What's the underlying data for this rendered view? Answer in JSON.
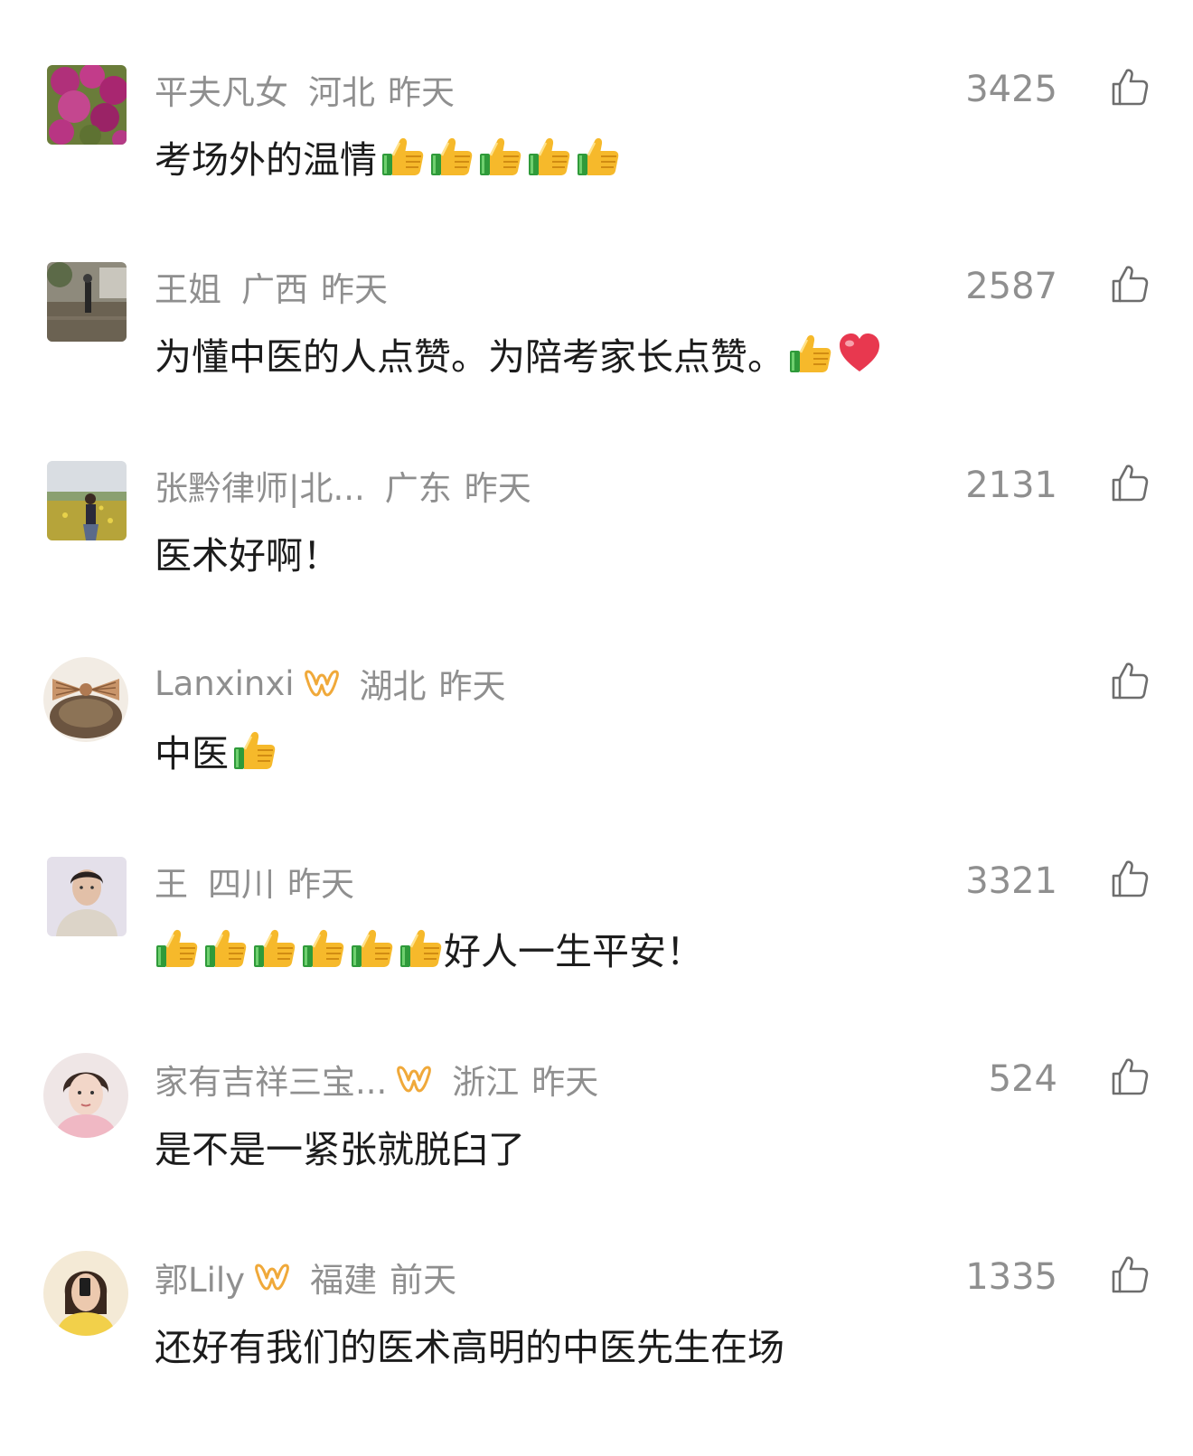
{
  "comments": [
    {
      "username": "平夫凡女",
      "location": "河北",
      "time": "昨天",
      "likes": "3425",
      "text": "考场外的温情",
      "vip": false
    },
    {
      "username": "王姐",
      "location": "广西",
      "time": "昨天",
      "likes": "2587",
      "text_part1": "为懂中医的人点赞。为陪考家长点赞。",
      "vip": false
    },
    {
      "username": "张黔律师|北...",
      "location": "广东",
      "time": "昨天",
      "likes": "2131",
      "text": "医术好啊！",
      "vip": false
    },
    {
      "username": "Lanxinxi",
      "location": "湖北",
      "time": "昨天",
      "likes": "",
      "text": "中医",
      "vip": true
    },
    {
      "username": "王",
      "location": "四川",
      "time": "昨天",
      "likes": "3321",
      "text": "好人一生平安！",
      "vip": false
    },
    {
      "username": "家有吉祥三宝...",
      "location": "浙江",
      "time": "昨天",
      "likes": "524",
      "text": "是不是一紧张就脱臼了",
      "vip": true
    },
    {
      "username": "郭Lily",
      "location": "福建",
      "time": "前天",
      "likes": "1335",
      "text": "还好有我们的医术高明的中医先生在场",
      "vip": true
    }
  ],
  "icons": {
    "like": "thumbs-up-outline-icon",
    "emoji_thumbs": "thumbs-up-emoji",
    "emoji_heart": "red-heart-emoji",
    "vip": "vip-badge-icon"
  },
  "colors": {
    "meta": "#8f8f8f",
    "text": "#1c1c1c",
    "vip_gold": "#f0a93a"
  }
}
